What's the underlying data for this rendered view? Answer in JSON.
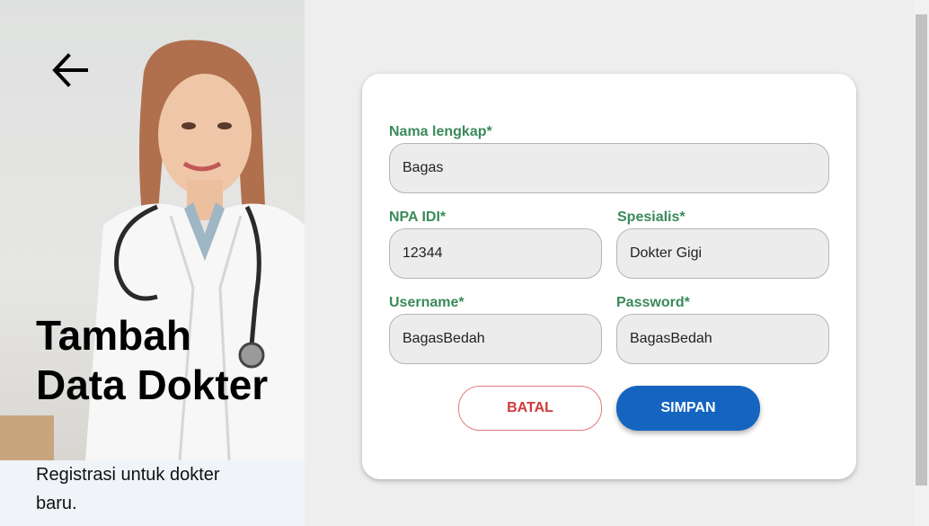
{
  "hero": {
    "title": "Tambah Data Dokter",
    "subtitle": "Registrasi untuk dokter baru."
  },
  "form": {
    "nama": {
      "label": "Nama lengkap*",
      "value": "Bagas"
    },
    "npa": {
      "label": "NPA IDI*",
      "value": "12344"
    },
    "spesialis": {
      "label": "Spesialis*",
      "value": "Dokter Gigi"
    },
    "username": {
      "label": "Username*",
      "value": "BagasBedah"
    },
    "password": {
      "label": "Password*",
      "value": "BagasBedah"
    }
  },
  "buttons": {
    "cancel": "BATAL",
    "save": "SIMPAN"
  },
  "colors": {
    "label": "#3a8a5a",
    "primary": "#1565c0",
    "cancel": "#d03a3a"
  },
  "icons": {
    "back": "arrow-left-icon"
  }
}
